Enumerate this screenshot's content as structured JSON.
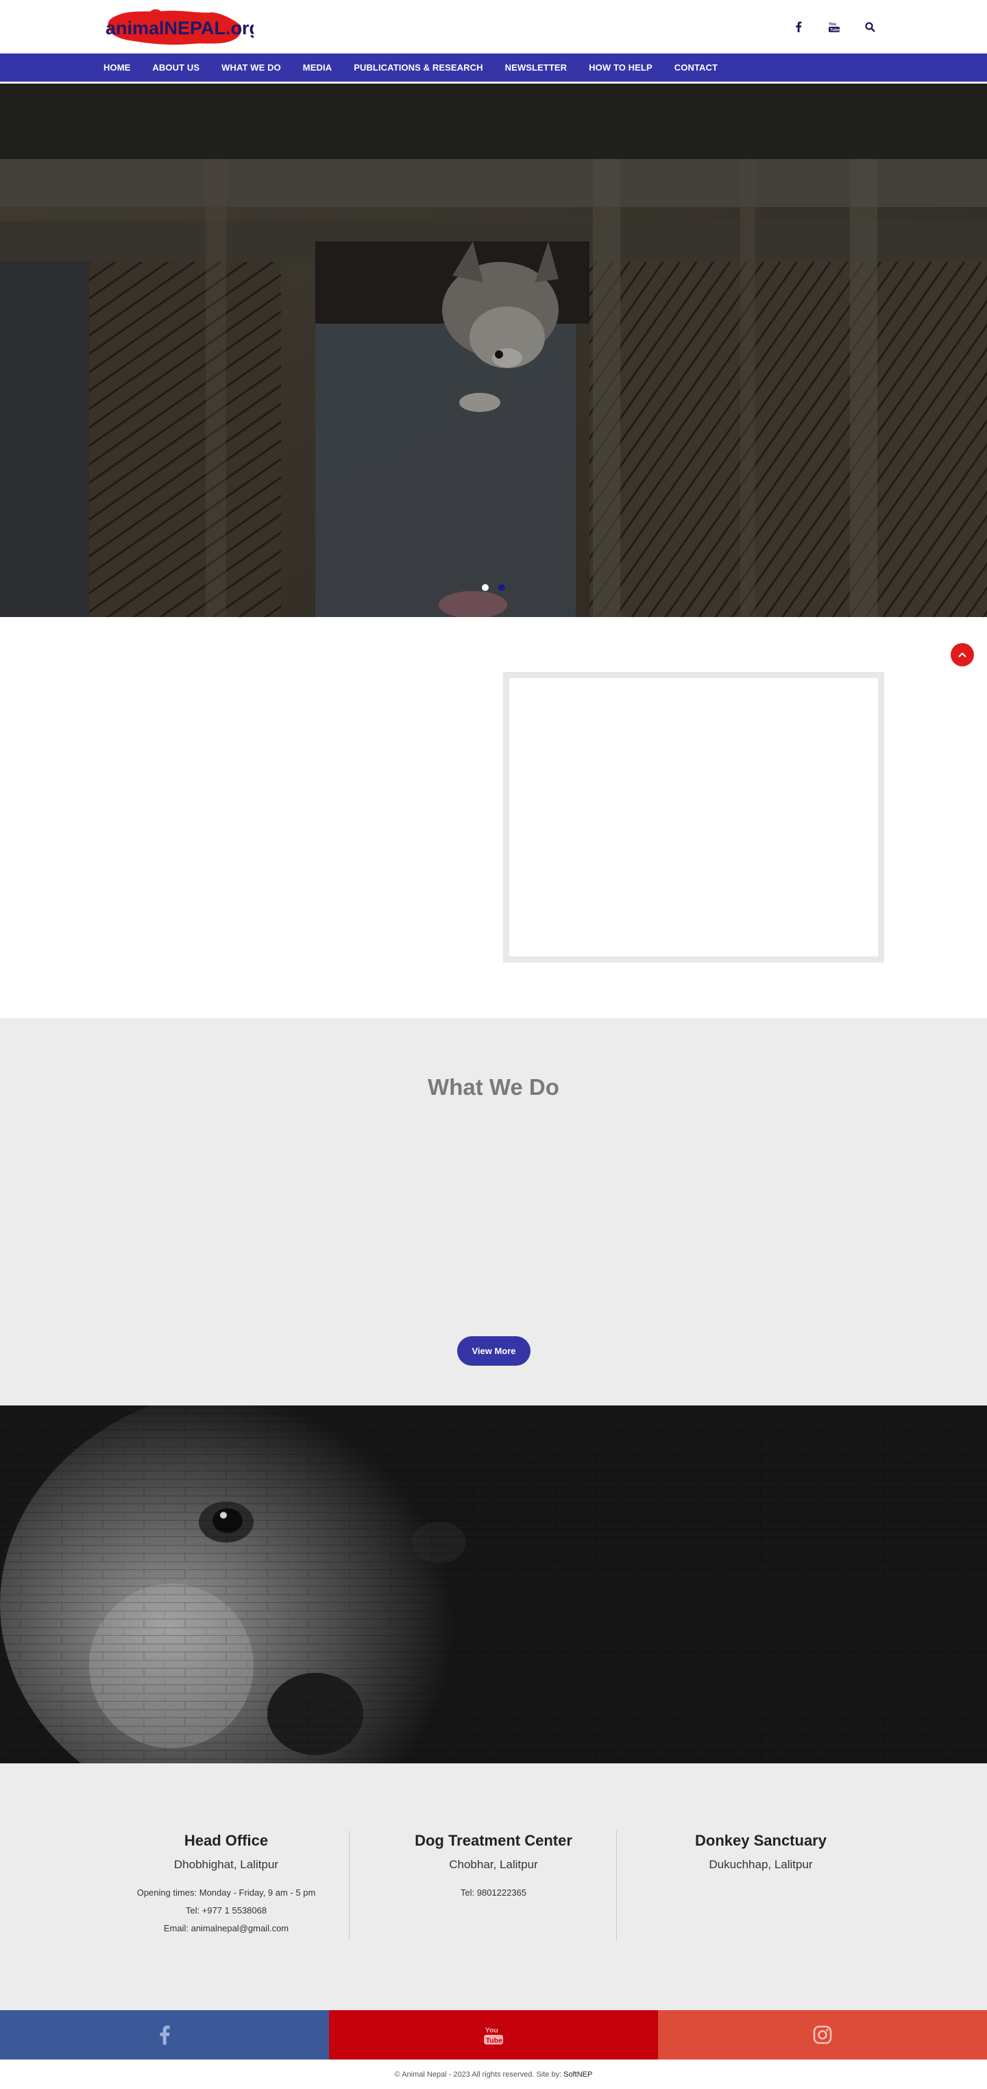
{
  "header": {
    "logo_text": "animalNEPAL.org",
    "icons": [
      "facebook-icon",
      "youtube-icon",
      "search-icon"
    ]
  },
  "nav": {
    "items": [
      "HOME",
      "ABOUT US",
      "WHAT WE DO",
      "MEDIA",
      "PUBLICATIONS & RESEARCH",
      "NEWSLETTER",
      "HOW TO HELP",
      "CONTACT"
    ]
  },
  "hero": {
    "active_slide": 1,
    "slide_count": 2
  },
  "whatwedo": {
    "title": "What We Do",
    "button_label": "View More"
  },
  "offices": [
    {
      "title": "Head Office",
      "location": "Dhobhighat, Lalitpur",
      "lines": [
        "Opening times: Monday - Friday, 9 am - 5 pm",
        "Tel: +977 1 5538068",
        "Email: animalnepal@gmail.com"
      ]
    },
    {
      "title": "Dog Treatment Center",
      "location": "Chobhar, Lalitpur",
      "lines": [
        "Tel: 9801222365"
      ]
    },
    {
      "title": "Donkey Sanctuary",
      "location": "Dukuchhap, Lalitpur",
      "lines": []
    }
  ],
  "footer": {
    "copyright": "© Animal Nepal - 2023 All rights reserved. Site by:",
    "credit": "SoftNEP"
  },
  "colors": {
    "nav": "#3535a8",
    "accent_red": "#e11b1b",
    "facebook": "#3b5998",
    "youtube": "#c4000b",
    "instagram": "#dd4b39"
  }
}
